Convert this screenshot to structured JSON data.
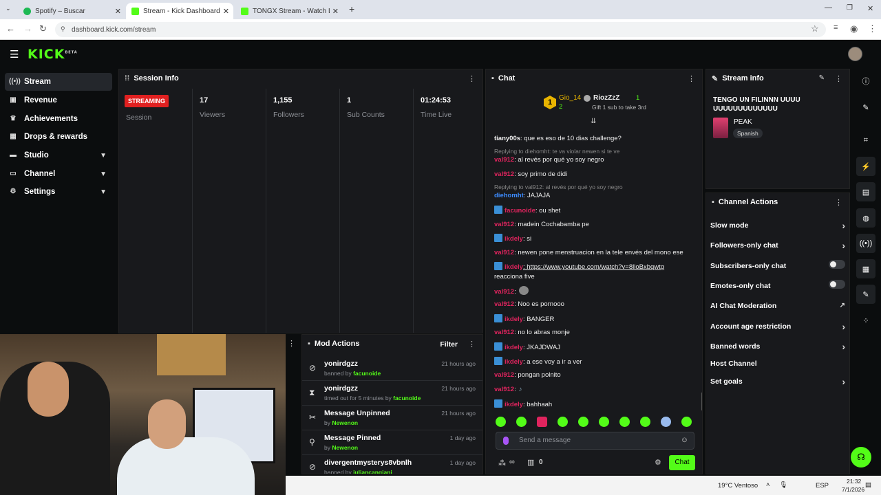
{
  "browser": {
    "tabs": [
      {
        "title": "Spotify – Buscar",
        "color": "#1db954"
      },
      {
        "title": "Stream - Kick Dashboard",
        "color": "#53fc18"
      },
      {
        "title": "TONGX Stream - Watch Live on",
        "color": "#53fc18"
      }
    ],
    "url": "dashboard.kick.com/stream"
  },
  "logo": "KICK",
  "logo_tag": "BETA",
  "sidebar": {
    "items": [
      {
        "label": "Stream",
        "icon": "signal-icon"
      },
      {
        "label": "Revenue",
        "icon": "money-icon"
      },
      {
        "label": "Achievements",
        "icon": "trophy-icon"
      },
      {
        "label": "Drops & rewards",
        "icon": "gift-icon"
      },
      {
        "label": "Studio",
        "icon": "studio-icon"
      },
      {
        "label": "Channel",
        "icon": "channel-icon"
      },
      {
        "label": "Settings",
        "icon": "gear-icon"
      }
    ]
  },
  "session": {
    "title": "Session Info",
    "status": "STREAMING",
    "status_label": "Session",
    "stats": [
      {
        "value": "17",
        "label": "Viewers"
      },
      {
        "value": "1,155",
        "label": "Followers"
      },
      {
        "value": "1",
        "label": "Sub Counts"
      },
      {
        "value": "01:24:53",
        "label": "Time Live"
      }
    ]
  },
  "chat": {
    "title": "Chat",
    "leader1": {
      "name": "Gio_14",
      "count": "2"
    },
    "leader2": {
      "name": "RiozZzZ",
      "count": "1",
      "note": "Gift 1 sub to take 3rd"
    },
    "messages": [
      {
        "user": "tiany00s",
        "text": ": que es eso de 10 dias challenge?",
        "color": "#eee",
        "badge": false
      },
      {
        "reply": "Replying to diehomht: te va violar newen si te ve"
      },
      {
        "user": "val912",
        "text": ": al revés por qué yo soy negro",
        "color": "#e0245e",
        "badge": false
      },
      {
        "user": "val912",
        "text": ": soy primo de didi",
        "color": "#e0245e",
        "badge": false
      },
      {
        "reply": "Replying to val912: al revés por qué yo soy negro"
      },
      {
        "user": "diehomht",
        "text": ": JAJAJA",
        "color": "#3d8cff",
        "badge": false
      },
      {
        "user": "facunoide",
        "text": ": ou shet",
        "color": "#e0245e",
        "badge": true
      },
      {
        "user": "val912",
        "text": ": madein Cochabamba pe",
        "color": "#e0245e",
        "badge": false
      },
      {
        "user": "ikdely",
        "text": ": si",
        "color": "#e0245e",
        "badge": true
      },
      {
        "user": "val912",
        "text": ": newen pone menstruacion en la tele envés del mono ese",
        "color": "#e0245e",
        "badge": false
      },
      {
        "user": "ikdely",
        "text": ": https://www.youtube.com/watch?v=8lloBxbqwtg",
        "color": "#e0245e",
        "badge": true
      },
      {
        "cont": "reacciona five"
      },
      {
        "user": "val912",
        "text": ":",
        "color": "#e0245e",
        "badge": false
      },
      {
        "user": "val912",
        "text": ": Noo es pornooo",
        "color": "#e0245e",
        "badge": false
      },
      {
        "user": "ikdely",
        "text": ": BANGER",
        "color": "#e0245e",
        "badge": true
      },
      {
        "user": "val912",
        "text": ": no lo abras monje",
        "color": "#e0245e",
        "badge": false
      },
      {
        "user": "ikdely",
        "text": ": JKAJDWAJ",
        "color": "#e0245e",
        "badge": true
      },
      {
        "user": "ikdely",
        "text": ": a ese voy a ir a ver",
        "color": "#e0245e",
        "badge": true
      },
      {
        "user": "val912",
        "text": ": pongan polnito",
        "color": "#e0245e",
        "badge": false
      },
      {
        "user": "val912",
        "text": ":",
        "color": "#e0245e",
        "badge": false
      },
      {
        "user": "ikdely",
        "text": ": bahhaah",
        "color": "#e0245e",
        "badge": true
      }
    ],
    "input_placeholder": "Send a message",
    "points": "∞",
    "pool": "0",
    "send_label": "Chat"
  },
  "stream_info": {
    "title": "Stream info",
    "stream_title": "TENGO UN FILINNN UUUU UUUUUUUUUUUUU",
    "category": "PEAK",
    "language": "Spanish"
  },
  "channel_actions": {
    "title": "Channel Actions",
    "items": [
      {
        "label": "Slow mode",
        "type": "chevron"
      },
      {
        "label": "Followers-only chat",
        "type": "chevron"
      },
      {
        "label": "Subscribers-only chat",
        "type": "toggle"
      },
      {
        "label": "Emotes-only chat",
        "type": "toggle"
      },
      {
        "label": "AI Chat Moderation",
        "type": "external"
      },
      {
        "label": "Account age restriction",
        "type": "chevron"
      },
      {
        "label": "Banned words",
        "type": "chevron"
      },
      {
        "label": "Host Channel",
        "type": "none"
      },
      {
        "label": "Set goals",
        "type": "chevron"
      }
    ]
  },
  "mod_actions": {
    "title": "Mod Actions",
    "filter": "Filter",
    "items": [
      {
        "title": "yonirdgzz",
        "pre": "banned by ",
        "by": "facunoide",
        "time": "21 hours ago",
        "icon": "ban-icon"
      },
      {
        "title": "yonirdgzz",
        "pre": "timed out for 5 minutes by ",
        "by": "facunoide",
        "time": "21 hours ago",
        "icon": "hourglass-icon"
      },
      {
        "title": "Message Unpinned",
        "pre": "by ",
        "by": "Newenon",
        "time": "21 hours ago",
        "icon": "unpin-icon"
      },
      {
        "title": "Message Pinned",
        "pre": "by ",
        "by": "Newenon",
        "time": "1 day ago",
        "icon": "pin-icon"
      },
      {
        "title": "divergentmysterys8vbnlh",
        "pre": "banned by ",
        "by": "juliancangiani",
        "time": "1 day ago",
        "icon": "ban-icon"
      }
    ]
  },
  "taskbar": {
    "weather": "19°C  Ventoso",
    "lang": "ESP",
    "time": "21:32",
    "date": "7/1/2026"
  }
}
